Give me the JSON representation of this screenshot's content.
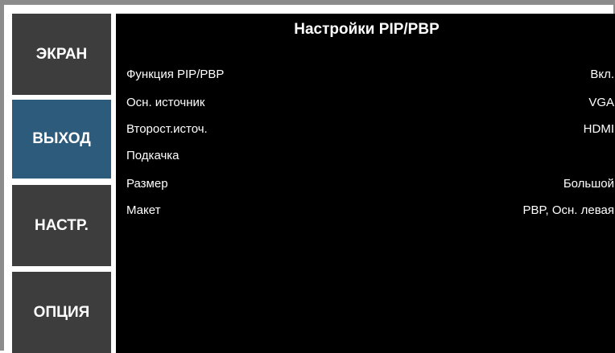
{
  "sidebar": {
    "items": [
      {
        "label": "ЭКРАН"
      },
      {
        "label": "ВЫХОД"
      },
      {
        "label": "НАСТР."
      },
      {
        "label": "ОПЦИЯ"
      }
    ]
  },
  "main": {
    "title": "Настройки PIP/PBP",
    "rows": [
      {
        "label": "Функция PIP/PBP",
        "value": "Вкл."
      },
      {
        "label": "Осн. источник",
        "value": "VGA"
      },
      {
        "label": "Второст.источ.",
        "value": "HDMI"
      },
      {
        "label": "Подкачка",
        "value": ""
      },
      {
        "label": "Размер",
        "value": "Большой"
      },
      {
        "label": "Макет",
        "value": "PBP, Осн. левая"
      }
    ]
  },
  "colors": {
    "active_tab": "#2c5b7c",
    "inactive_tab": "#3d3d3d",
    "panel_background": "#000000",
    "frame": "#8c8c8c"
  }
}
